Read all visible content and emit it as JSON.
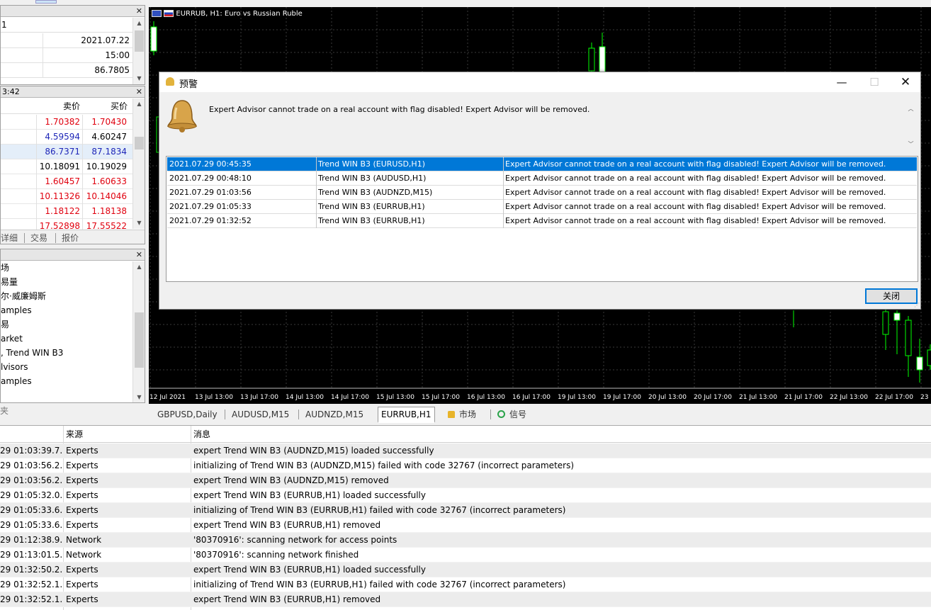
{
  "data_window": {
    "header_text": "1",
    "rows": [
      {
        "value": "2021.07.22"
      },
      {
        "value": "15:00"
      },
      {
        "value": "86.7805"
      }
    ]
  },
  "market_watch": {
    "title_time": "3:42",
    "col_bid": "卖价",
    "col_ask": "买价",
    "rows": [
      {
        "bid": "1.70382",
        "ask": "1.70430",
        "bid_color": "red",
        "ask_color": "red"
      },
      {
        "bid": "4.59594",
        "ask": "4.60247",
        "bid_color": "blue",
        "ask_color": "black"
      },
      {
        "bid": "86.7371",
        "ask": "87.1834",
        "bid_color": "blue",
        "ask_color": "blue"
      },
      {
        "bid": "10.18091",
        "ask": "10.19029",
        "bid_color": "black",
        "ask_color": "black"
      },
      {
        "bid": "1.60457",
        "ask": "1.60633",
        "bid_color": "red",
        "ask_color": "red"
      },
      {
        "bid": "10.11326",
        "ask": "10.14046",
        "bid_color": "red",
        "ask_color": "red"
      },
      {
        "bid": "1.18122",
        "ask": "1.18138",
        "bid_color": "red",
        "ask_color": "red"
      },
      {
        "bid": "17.52898",
        "ask": "17.55522",
        "bid_color": "red",
        "ask_color": "red"
      }
    ],
    "tabs": [
      "详细",
      "交易",
      "报价"
    ]
  },
  "navigator": {
    "items": [
      "场",
      "易量",
      "尔·威廉姆斯",
      "amples",
      "易",
      "arket",
      ", Trend WIN B3",
      "lvisors",
      "amples"
    ],
    "footer": "夹"
  },
  "chart": {
    "title": "EURRUB, H1:  Euro vs Russian Ruble",
    "time_labels": [
      "12 Jul 2021",
      "13 Jul 13:00",
      "13 Jul 17:00",
      "14 Jul 13:00",
      "14 Jul 17:00",
      "15 Jul 13:00",
      "15 Jul 17:00",
      "16 Jul 13:00",
      "16 Jul 17:00",
      "19 Jul 13:00",
      "19 Jul 17:00",
      "20 Jul 13:00",
      "20 Jul 17:00",
      "21 Jul 13:00",
      "21 Jul 17:00",
      "22 Jul 13:00",
      "22 Jul 17:00",
      "23"
    ]
  },
  "alert_dialog": {
    "title": "预警",
    "message": "Expert Advisor cannot trade on a real account with flag disabled! Expert Advisor will be removed.",
    "rows": [
      {
        "time": "2021.07.29 00:45:35",
        "source": "Trend WIN B3 (EURUSD,H1)",
        "message": "Expert Advisor cannot trade on a real account with flag disabled! Expert Advisor will be removed."
      },
      {
        "time": "2021.07.29 00:48:10",
        "source": "Trend WIN B3 (AUDUSD,H1)",
        "message": "Expert Advisor cannot trade on a real account with flag disabled! Expert Advisor will be removed."
      },
      {
        "time": "2021.07.29 01:03:56",
        "source": "Trend WIN B3 (AUDNZD,M15)",
        "message": "Expert Advisor cannot trade on a real account with flag disabled! Expert Advisor will be removed."
      },
      {
        "time": "2021.07.29 01:05:33",
        "source": "Trend WIN B3 (EURRUB,H1)",
        "message": "Expert Advisor cannot trade on a real account with flag disabled! Expert Advisor will be removed."
      },
      {
        "time": "2021.07.29 01:32:52",
        "source": "Trend WIN B3 (EURRUB,H1)",
        "message": "Expert Advisor cannot trade on a real account with flag disabled! Expert Advisor will be removed."
      }
    ],
    "close_label": "关闭"
  },
  "chart_tabs": [
    "GBPUSD,Daily",
    "AUDUSD,M15",
    "AUDNZD,M15",
    "EURRUB,H1",
    "市场",
    "信号"
  ],
  "journal": {
    "col_source": "来源",
    "col_message": "消息",
    "rows": [
      {
        "time": "29 01:03:39.7...",
        "source": "Experts",
        "message": "expert Trend WIN B3 (AUDNZD,M15) loaded successfully"
      },
      {
        "time": "29 01:03:56.2...",
        "source": "Experts",
        "message": "initializing of Trend WIN B3 (AUDNZD,M15) failed with code 32767 (incorrect parameters)"
      },
      {
        "time": "29 01:03:56.2...",
        "source": "Experts",
        "message": "expert Trend WIN B3 (AUDNZD,M15) removed"
      },
      {
        "time": "29 01:05:32.0...",
        "source": "Experts",
        "message": "expert Trend WIN B3 (EURRUB,H1) loaded successfully"
      },
      {
        "time": "29 01:05:33.6...",
        "source": "Experts",
        "message": "initializing of Trend WIN B3 (EURRUB,H1) failed with code 32767 (incorrect parameters)"
      },
      {
        "time": "29 01:05:33.6...",
        "source": "Experts",
        "message": "expert Trend WIN B3 (EURRUB,H1) removed"
      },
      {
        "time": "29 01:12:38.9...",
        "source": "Network",
        "message": "'80370916': scanning network for access points"
      },
      {
        "time": "29 01:13:01.5...",
        "source": "Network",
        "message": "'80370916': scanning network finished"
      },
      {
        "time": "29 01:32:50.2...",
        "source": "Experts",
        "message": "expert Trend WIN B3 (EURRUB,H1) loaded successfully"
      },
      {
        "time": "29 01:32:52.1...",
        "source": "Experts",
        "message": "initializing of Trend WIN B3 (EURRUB,H1) failed with code 32767 (incorrect parameters)"
      },
      {
        "time": "29 01:32:52.1...",
        "source": "Experts",
        "message": "expert Trend WIN B3 (EURRUB,H1) removed"
      }
    ]
  },
  "colors": {
    "red": "#e0000e",
    "blue": "#1e26b8",
    "black": "#000000",
    "selection": "#0078d7",
    "candle": "#00ff00"
  }
}
